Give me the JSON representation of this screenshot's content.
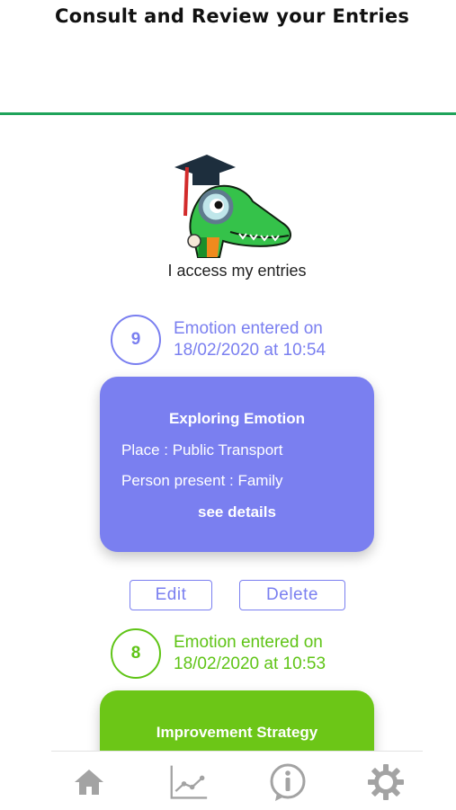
{
  "header": {
    "title": "Consult and Review your Entries"
  },
  "colors": {
    "accent_line": "#1fa35a",
    "purple": "#7a7ff0",
    "green": "#6cc617",
    "tab_icon": "#a3a3a3"
  },
  "intro": {
    "mascot_icon": "crocodile-with-magnifier-mascot",
    "caption": "I access my entries"
  },
  "entries": [
    {
      "number": "9",
      "date_line1": "Emotion entered on",
      "date_line2": "18/02/2020 at 10:54",
      "card_title": "Exploring Emotion",
      "place": "Place : Public Transport",
      "person": "Person present : Family",
      "details_link": "see details",
      "edit_label": "Edit",
      "delete_label": "Delete"
    },
    {
      "number": "8",
      "date_line1": "Emotion entered on",
      "date_line2": "18/02/2020 at 10:53",
      "card_title": "Improvement Strategy"
    }
  ],
  "tabbar": {
    "items": [
      {
        "icon": "home-icon"
      },
      {
        "icon": "chart-icon"
      },
      {
        "icon": "info-icon"
      },
      {
        "icon": "gear-icon"
      }
    ]
  }
}
